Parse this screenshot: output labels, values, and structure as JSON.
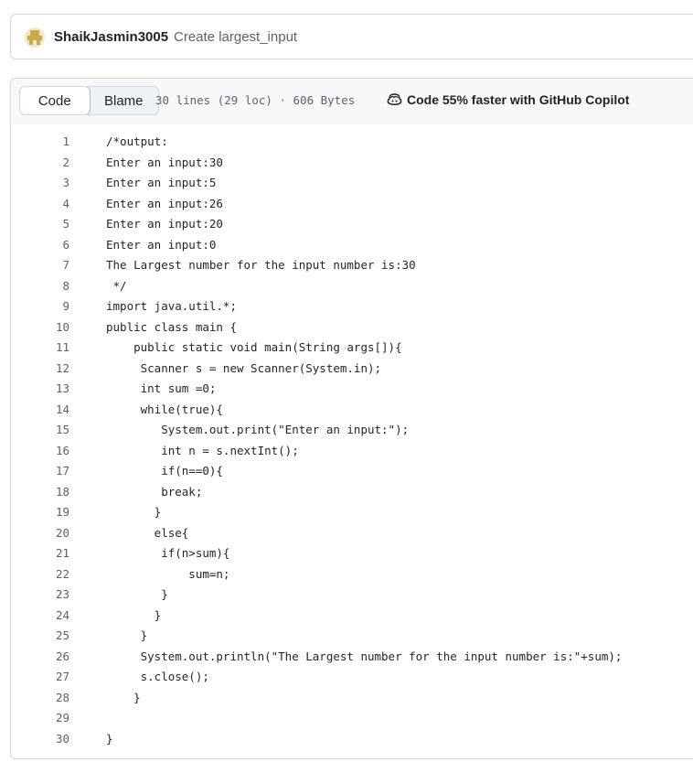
{
  "commit": {
    "author": "ShaikJasmin3005",
    "message": "Create largest_input"
  },
  "file_header": {
    "code_tab": "Code",
    "blame_tab": "Blame",
    "meta": "30 lines (29 loc) · 606 Bytes",
    "copilot_label": "Code 55% faster with GitHub Copilot",
    "copilot_icon": "copilot-icon"
  },
  "code": [
    {
      "n": "1",
      "text": "/*output:"
    },
    {
      "n": "2",
      "text": "Enter an input:30"
    },
    {
      "n": "3",
      "text": "Enter an input:5"
    },
    {
      "n": "4",
      "text": "Enter an input:26"
    },
    {
      "n": "5",
      "text": "Enter an input:20"
    },
    {
      "n": "6",
      "text": "Enter an input:0"
    },
    {
      "n": "7",
      "text": "The Largest number for the input number is:30"
    },
    {
      "n": "8",
      "text": " */"
    },
    {
      "n": "9",
      "text": "import java.util.*;"
    },
    {
      "n": "10",
      "text": "public class main {"
    },
    {
      "n": "11",
      "text": "    public static void main(String args[]){"
    },
    {
      "n": "12",
      "text": "     Scanner s = new Scanner(System.in);"
    },
    {
      "n": "13",
      "text": "     int sum =0;"
    },
    {
      "n": "14",
      "text": "     while(true){"
    },
    {
      "n": "15",
      "text": "        System.out.print(\"Enter an input:\");"
    },
    {
      "n": "16",
      "text": "        int n = s.nextInt();"
    },
    {
      "n": "17",
      "text": "        if(n==0){"
    },
    {
      "n": "18",
      "text": "        break;"
    },
    {
      "n": "19",
      "text": "       }"
    },
    {
      "n": "20",
      "text": "       else{"
    },
    {
      "n": "21",
      "text": "        if(n>sum){"
    },
    {
      "n": "22",
      "text": "            sum=n;"
    },
    {
      "n": "23",
      "text": "        }"
    },
    {
      "n": "24",
      "text": "       }"
    },
    {
      "n": "25",
      "text": "     }"
    },
    {
      "n": "26",
      "text": "     System.out.println(\"The Largest number for the input number is:\"+sum);"
    },
    {
      "n": "27",
      "text": "     s.close();"
    },
    {
      "n": "28",
      "text": "    }"
    },
    {
      "n": "29",
      "text": ""
    },
    {
      "n": "30",
      "text": "}"
    }
  ]
}
